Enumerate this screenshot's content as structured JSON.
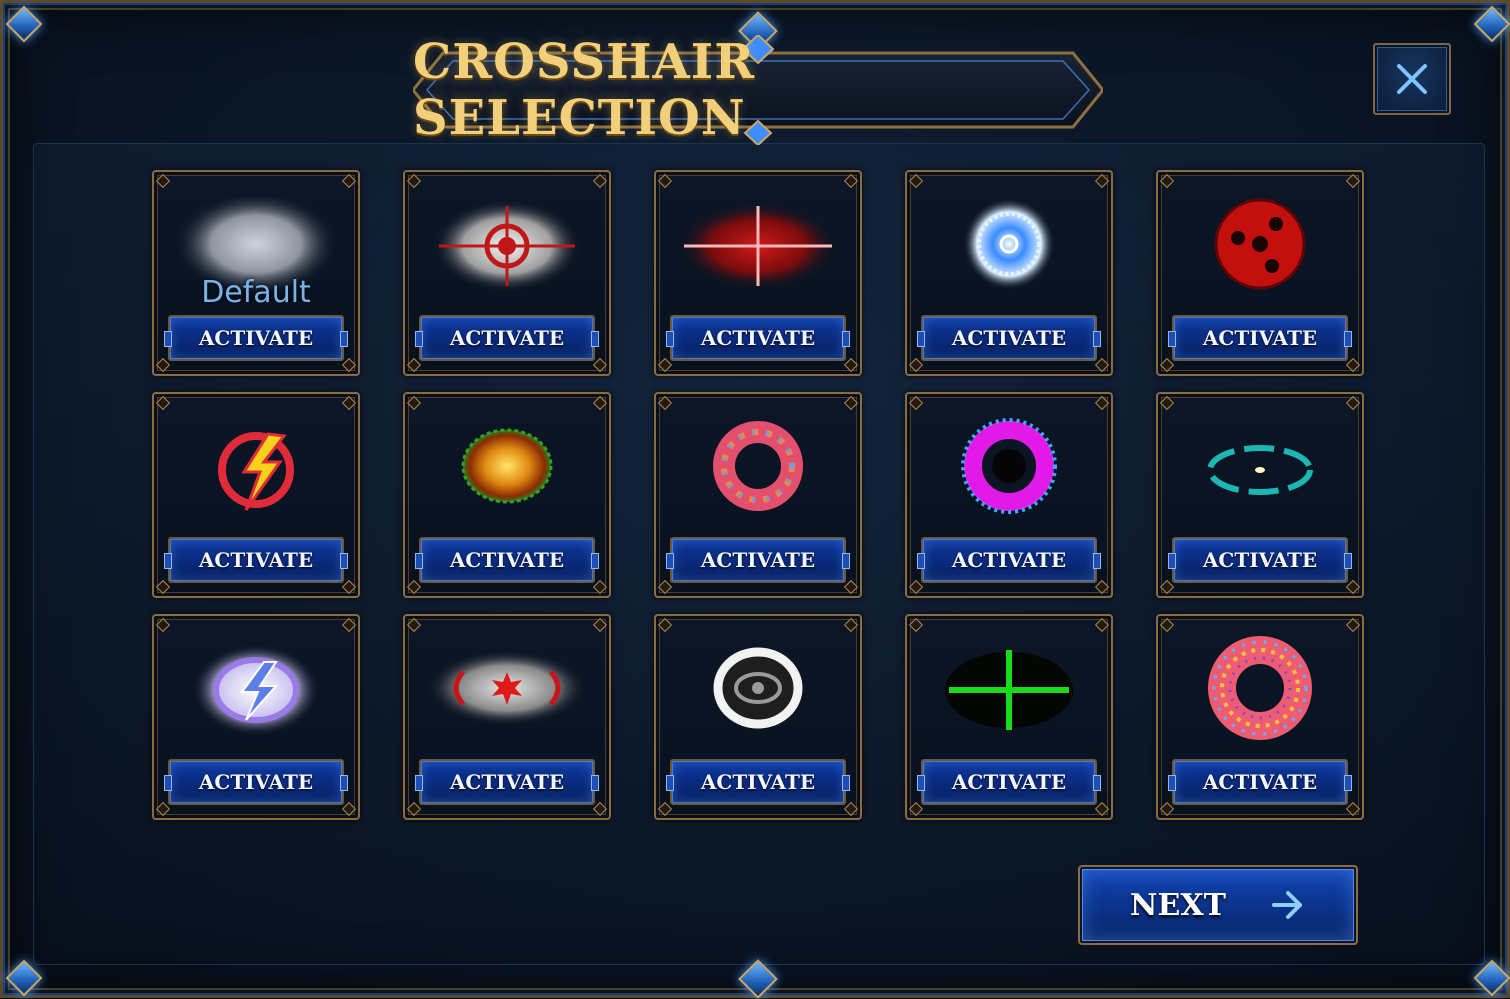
{
  "header": {
    "title": "CROSSHAIR SELECTION"
  },
  "close_button": {
    "icon": "close-icon"
  },
  "default_label": "Default",
  "crosshairs": [
    {
      "icon": "blur-gray-crosshair-icon",
      "button_label": "ACTIVATE",
      "is_default": true
    },
    {
      "icon": "red-target-crosshair-icon",
      "button_label": "ACTIVATE"
    },
    {
      "icon": "red-cross-crosshair-icon",
      "button_label": "ACTIVATE"
    },
    {
      "icon": "blue-glow-ring-crosshair-icon",
      "button_label": "ACTIVATE"
    },
    {
      "icon": "red-sharingan-crosshair-icon",
      "button_label": "ACTIVATE"
    },
    {
      "icon": "red-lightning-emblem-crosshair-icon",
      "button_label": "ACTIVATE"
    },
    {
      "icon": "fire-orb-crosshair-icon",
      "button_label": "ACTIVATE"
    },
    {
      "icon": "colorful-ring-crosshair-icon",
      "button_label": "ACTIVATE"
    },
    {
      "icon": "magenta-dotted-ring-crosshair-icon",
      "button_label": "ACTIVATE"
    },
    {
      "icon": "teal-dashed-ring-crosshair-icon",
      "button_label": "ACTIVATE"
    },
    {
      "icon": "purple-lightning-crosshair-icon",
      "button_label": "ACTIVATE"
    },
    {
      "icon": "red-star-bracket-crosshair-icon",
      "button_label": "ACTIVATE"
    },
    {
      "icon": "gray-eye-ring-crosshair-icon",
      "button_label": "ACTIVATE"
    },
    {
      "icon": "green-plus-crosshair-icon",
      "button_label": "ACTIVATE"
    },
    {
      "icon": "patterned-donut-crosshair-icon",
      "button_label": "ACTIVATE"
    }
  ],
  "next_button": {
    "label": "NEXT",
    "icon": "arrow-right-icon"
  },
  "colors": {
    "accent_gold": "#f2cf7a",
    "button_blue": "#0a2c83",
    "frame_gold": "#8a6c3e"
  }
}
